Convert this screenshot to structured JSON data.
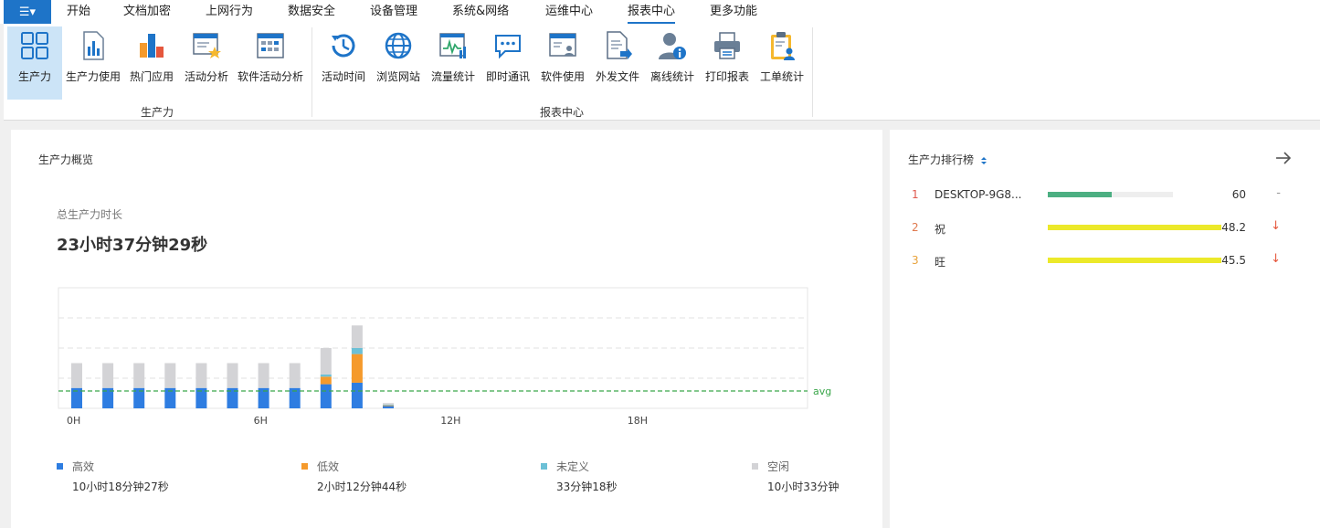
{
  "menu": {
    "app_icon": "☰▾",
    "items": [
      "开始",
      "文档加密",
      "上网行为",
      "数据安全",
      "设备管理",
      "系统&网络",
      "运维中心",
      "报表中心",
      "更多功能"
    ],
    "active": "报表中心"
  },
  "ribbon": {
    "groups": [
      {
        "label": "生产力",
        "buttons": [
          "生产力",
          "生产力使用",
          "热门应用",
          "活动分析",
          "软件活动分析"
        ]
      },
      {
        "label": "报表中心",
        "buttons": [
          "活动时间",
          "浏览网站",
          "流量统计",
          "即时通讯",
          "软件使用",
          "外发文件",
          "离线统计",
          "打印报表",
          "工单统计"
        ]
      }
    ],
    "active_button": "生产力"
  },
  "overview": {
    "title": "生产力概览",
    "total_label": "总生产力时长",
    "total_value": "23小时37分钟29秒",
    "avg_label": "avg",
    "legend": [
      {
        "name": "高效",
        "value": "10小时18分钟27秒",
        "color": "#2e7de1"
      },
      {
        "name": "低效",
        "value": "2小时12分钟44秒",
        "color": "#f59a2c"
      },
      {
        "name": "未定义",
        "value": "33分钟18秒",
        "color": "#6cc0d6"
      },
      {
        "name": "空闲",
        "value": "10小时33分钟",
        "color": "#d3d3d6"
      }
    ]
  },
  "chart_data": {
    "type": "bar",
    "stacked": true,
    "x_tick_labels": [
      "0H",
      "6H",
      "12H",
      "18H"
    ],
    "categories": [
      "0",
      "1",
      "2",
      "3",
      "4",
      "5",
      "6",
      "7",
      "8",
      "9",
      "10",
      "11",
      "12",
      "13",
      "14",
      "15",
      "16",
      "17",
      "18",
      "19",
      "20",
      "21",
      "22",
      "23"
    ],
    "series": [
      {
        "name": "高效",
        "color": "#2e7de1",
        "values": [
          27,
          27,
          27,
          27,
          27,
          27,
          27,
          27,
          32,
          34,
          3,
          0,
          0,
          0,
          0,
          0,
          0,
          0,
          0,
          0,
          0,
          0,
          0,
          0
        ]
      },
      {
        "name": "低效",
        "color": "#f59a2c",
        "values": [
          0,
          0,
          0,
          0,
          0,
          0,
          0,
          0,
          10,
          38,
          1,
          0,
          0,
          0,
          0,
          0,
          0,
          0,
          0,
          0,
          0,
          0,
          0,
          0
        ]
      },
      {
        "name": "未定义",
        "color": "#6cc0d6",
        "values": [
          0,
          0,
          0,
          0,
          0,
          0,
          0,
          0,
          3,
          8,
          1,
          0,
          0,
          0,
          0,
          0,
          0,
          0,
          0,
          0,
          0,
          0,
          0,
          0
        ]
      },
      {
        "name": "空闲",
        "color": "#d3d3d6",
        "values": [
          33,
          33,
          33,
          33,
          33,
          33,
          33,
          33,
          35,
          30,
          2,
          0,
          0,
          0,
          0,
          0,
          0,
          0,
          0,
          0,
          0,
          0,
          0,
          0
        ]
      }
    ],
    "avg": 23,
    "ylim": [
      0,
      160
    ],
    "grid": true
  },
  "ranking": {
    "title": "生产力排行榜",
    "sort_icon": "sort-icon",
    "arrow_icon": "arrow-right-icon",
    "rows": [
      {
        "rank": "1",
        "name": "DESKTOP-9G8...",
        "value": "60",
        "fraction": 0.5,
        "track": 0.72,
        "bar_color": "#4caf82",
        "trend": "-",
        "rank_color": "#e05a4f",
        "trend_color": "#999"
      },
      {
        "rank": "2",
        "name": "祝",
        "value": "48.2",
        "fraction": 1.0,
        "track": 1.0,
        "bar_color": "#ece92a",
        "trend": "↓",
        "rank_color": "#e07a4f",
        "trend_color": "#e5573d"
      },
      {
        "rank": "3",
        "name": "旺",
        "value": "45.5",
        "fraction": 1.0,
        "track": 1.0,
        "bar_color": "#ece92a",
        "trend": "↓",
        "rank_color": "#e8a23a",
        "trend_color": "#e5573d"
      }
    ]
  }
}
